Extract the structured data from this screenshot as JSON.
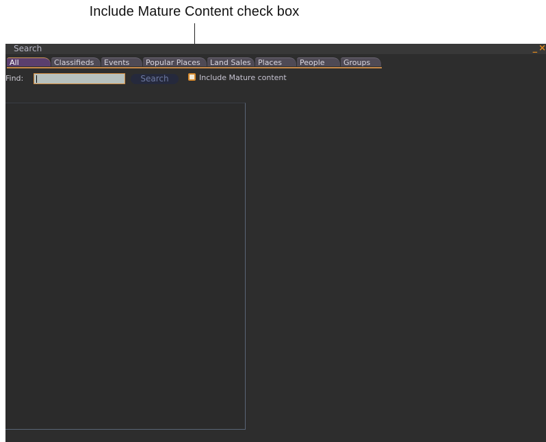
{
  "annotation": {
    "callout_text": "Include Mature Content check box"
  },
  "window": {
    "title": "Search",
    "minimize_symbol": "_",
    "close_symbol": "×"
  },
  "tabs": [
    {
      "label": "All",
      "active": true
    },
    {
      "label": "Classifieds",
      "active": false
    },
    {
      "label": "Events",
      "active": false
    },
    {
      "label": "Popular Places",
      "active": false
    },
    {
      "label": "Land Sales",
      "active": false
    },
    {
      "label": "Places",
      "active": false
    },
    {
      "label": "People",
      "active": false
    },
    {
      "label": "Groups",
      "active": false
    }
  ],
  "find": {
    "label": "Find:",
    "value": "",
    "search_button": "Search"
  },
  "mature": {
    "label": "Include Mature content",
    "checked": false
  },
  "colors": {
    "window_bg": "#2d2d2d",
    "accent_orange": "#d38c3d",
    "active_tab": "#5b3f6e",
    "inactive_tab": "#4f4a55",
    "search_button_bg": "#25293c"
  }
}
